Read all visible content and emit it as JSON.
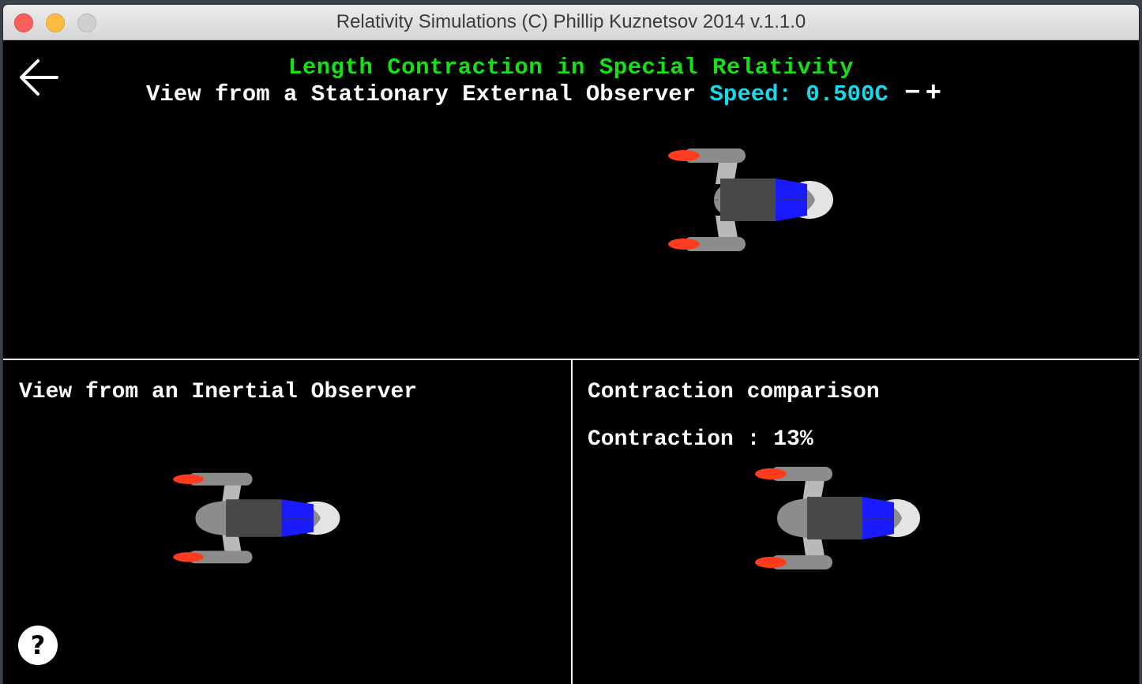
{
  "window": {
    "title": "Relativity Simulations (C) Phillip Kuznetsov 2014 v.1.1.0"
  },
  "header": {
    "title": "Length Contraction in Special Relativity",
    "subtitle": "View from a Stationary External Observer",
    "speed_label": "Speed:",
    "speed_value": "0.500C",
    "decrease_label": "−",
    "increase_label": "+"
  },
  "panels": {
    "inertial": {
      "label": "View from an Inertial Observer"
    },
    "comparison": {
      "label": "Contraction comparison",
      "contraction_text": "Contraction : 13%"
    }
  },
  "icons": {
    "back": "back-arrow-icon",
    "help": "help-icon",
    "ship": "spaceship"
  },
  "colors": {
    "title_green": "#18e018",
    "speed_cyan": "#19d8e8",
    "ship_cockpit_blue": "#1a1aff",
    "ship_flame_red": "#ff3b1f"
  }
}
